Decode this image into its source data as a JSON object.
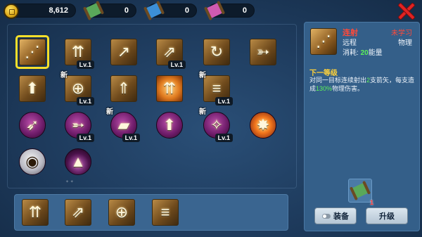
{
  "currency": {
    "gold": "8,612",
    "scroll_green": "0",
    "scroll_blue": "0",
    "scroll_pink": "0"
  },
  "colors": {
    "scroll_green": "#5aa85a",
    "scroll_blue": "#3c8fd6",
    "scroll_pink": "#d05ab0",
    "accent_red": "#e02323",
    "highlight_yellow": "#f7e02a"
  },
  "skills": {
    "s01": {
      "icon": "triple-arrow-icon"
    },
    "s02": {
      "icon": "arrow-fan-icon",
      "level": "Lv.1"
    },
    "s03": {
      "icon": "curved-arrow-icon"
    },
    "s04": {
      "icon": "arrow-volley-icon",
      "level": "Lv.1"
    },
    "s05": {
      "icon": "spinning-arrow-icon"
    },
    "s06": {
      "icon": "piercing-arrow-icon"
    },
    "s07": {
      "icon": "drill-arrow-icon"
    },
    "s08": {
      "icon": "crosshair-icon",
      "badge": "新",
      "level": "Lv.1"
    },
    "s09": {
      "icon": "heavy-arrow-icon"
    },
    "s10": {
      "icon": "fire-arrows-icon"
    },
    "s11": {
      "icon": "speed-boots-icon",
      "badge": "新",
      "level": "Lv.1"
    },
    "s12": {
      "icon": "crossbow-icon"
    },
    "s13": {
      "icon": "swift-arrow-icon",
      "level": "Lv.1"
    },
    "s14": {
      "icon": "boots-icon",
      "badge": "新",
      "level": "Lv.1"
    },
    "s15": {
      "icon": "boots-upgrade-icon"
    },
    "s16": {
      "icon": "winged-boots-icon",
      "badge": "新",
      "level": "Lv.1"
    },
    "s17": {
      "icon": "explosion-icon"
    },
    "s18": {
      "icon": "eye-icon"
    },
    "s19": {
      "icon": "shadow-beast-icon"
    }
  },
  "equipped": [
    {
      "icon": "arrow-fan-icon"
    },
    {
      "icon": "arrow-volley-icon"
    },
    {
      "icon": "crosshair-icon"
    },
    {
      "icon": "boots-icon"
    }
  ],
  "detail": {
    "name": "连射",
    "status": "未学习",
    "range": "远程",
    "type": "物理",
    "cost_prefix": "消耗: ",
    "cost_value": "20",
    "cost_suffix": "能量",
    "next_level_title": "下一等级",
    "desc_1": "对同一目标连续射出",
    "desc_count": "2",
    "desc_2": "支箭矢，每支造成",
    "desc_pct": "130%",
    "desc_3": "物理伤害。",
    "item_count": "1",
    "equip_label": "装备",
    "upgrade_label": "升级"
  }
}
